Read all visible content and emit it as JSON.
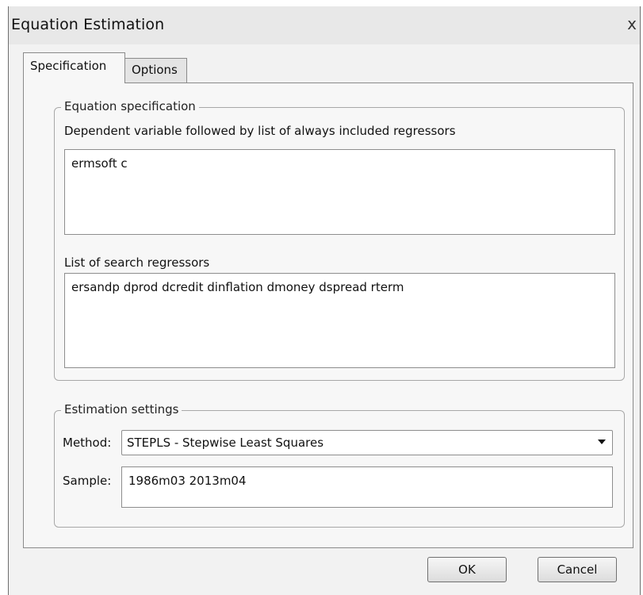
{
  "window": {
    "title": "Equation Estimation",
    "close_glyph": "x"
  },
  "tabs": [
    {
      "label": "Specification",
      "active": true
    },
    {
      "label": "Options",
      "active": false
    }
  ],
  "equation_spec": {
    "group_label": "Equation specification",
    "dependent_label": "Dependent variable followed by list of always included regressors",
    "dependent_value": "ermsoft c",
    "search_label": "List of search regressors",
    "search_value": "ersandp dprod dcredit dinflation dmoney dspread rterm"
  },
  "estimation_settings": {
    "group_label": "Estimation settings",
    "method_label": "Method:",
    "method_value": "STEPLS  -  Stepwise Least Squares",
    "sample_label": "Sample:",
    "sample_value": "1986m03 2013m04"
  },
  "buttons": {
    "ok": "OK",
    "cancel": "Cancel"
  }
}
